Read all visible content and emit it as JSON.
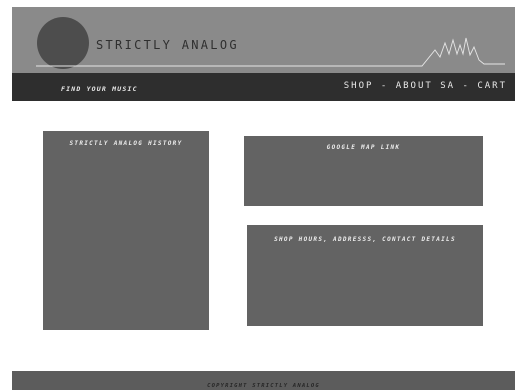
{
  "header": {
    "site_title": "STRICTLY ANALOG",
    "logo_icon": "circle-logo-icon",
    "waveform_icon": "waveform-icon"
  },
  "nav": {
    "tagline": "FIND YOUR MUSIC",
    "links": [
      {
        "label": "SHOP"
      },
      {
        "label": "ABOUT SA"
      },
      {
        "label": "CART"
      }
    ],
    "separator": "-"
  },
  "main": {
    "history_label": "STRICTLY ANALOG HISTORY",
    "map_label": "GOOGLE MAP LINK",
    "contact_label": "SHOP HOURS, ADDRESSS, CONTACT DETAILS"
  },
  "footer": {
    "copyright": "COPYRIGHT STRICTLY ANALOG"
  },
  "colors": {
    "header_bg": "#8a8a8a",
    "logo": "#4d4d4d",
    "navbar_bg": "#2e2e2e",
    "box_bg": "#636363",
    "footer_bg": "#5c5c5c",
    "waveform": "#e6e6e6"
  }
}
